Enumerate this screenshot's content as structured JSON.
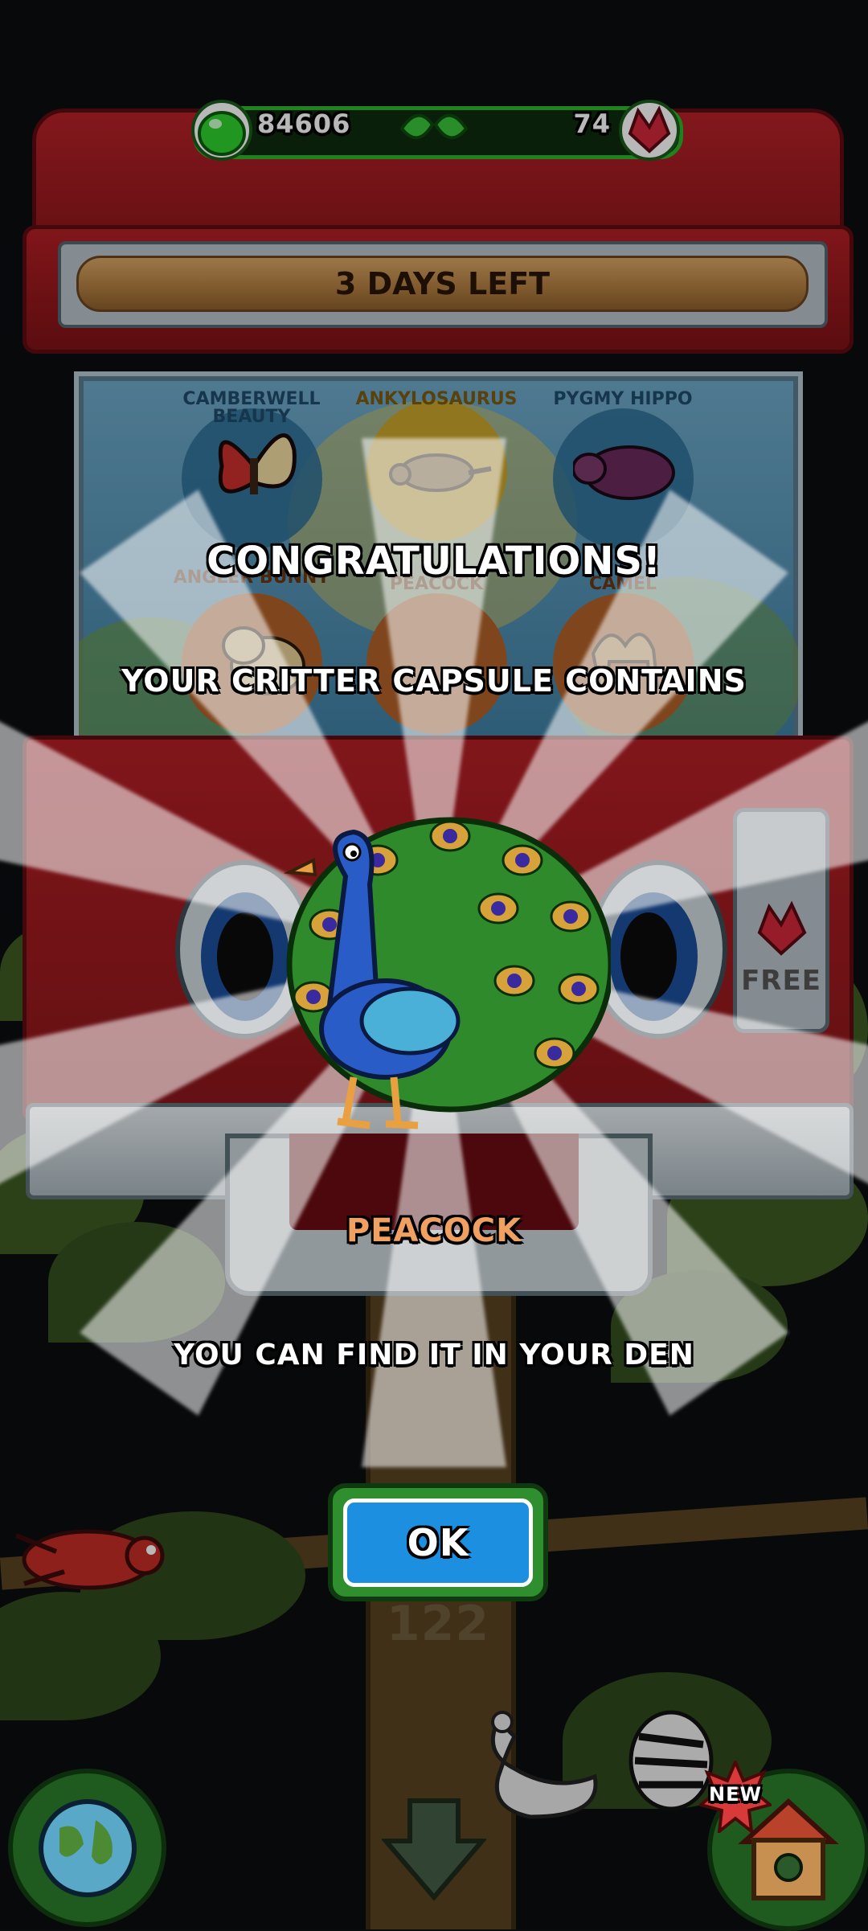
{
  "currency": {
    "gems_count": "84606",
    "crystals_count": "74",
    "colors": {
      "bar": "#1e7a1e",
      "gem": "#2fd12f",
      "crystal": "#d2283a"
    }
  },
  "machine": {
    "timer_label": "3 DAYS LEFT",
    "free_label": "FREE"
  },
  "critters": [
    {
      "name": "CAMBERWELL BEAUTY",
      "circle": "#2b6d94",
      "label_color": "#1f4c6b",
      "icon": "butterfly-icon"
    },
    {
      "name": "ANKYLOSAURUS",
      "circle": "#c8a42a",
      "label_color": "#7a5a10",
      "icon": "ankylosaurus-icon"
    },
    {
      "name": "PYGMY HIPPO",
      "circle": "#2b6d94",
      "label_color": "#1f4c6b",
      "icon": "hippo-icon"
    },
    {
      "name": "ANGLER BUNNY",
      "circle": "#b0622a",
      "label_color": "#6a3512",
      "icon": "bunny-icon"
    },
    {
      "name": "PEACOCK",
      "circle": "#b0622a",
      "label_color": "#6a3512",
      "icon": "peacock-icon"
    },
    {
      "name": "CAMEL",
      "circle": "#b0622a",
      "label_color": "#6a3512",
      "icon": "camel-icon"
    }
  ],
  "reward": {
    "title": "CONGRATULATIONS!",
    "subtitle": "YOUR CRITTER CAPSULE CONTAINS",
    "critter_name": "PEACOCK",
    "critter_name_color": "#f0a060",
    "info": "YOU CAN FIND IT IN YOUR DEN",
    "ok_label": "OK"
  },
  "bottom": {
    "tree_level": "122",
    "new_badge": "NEW"
  }
}
